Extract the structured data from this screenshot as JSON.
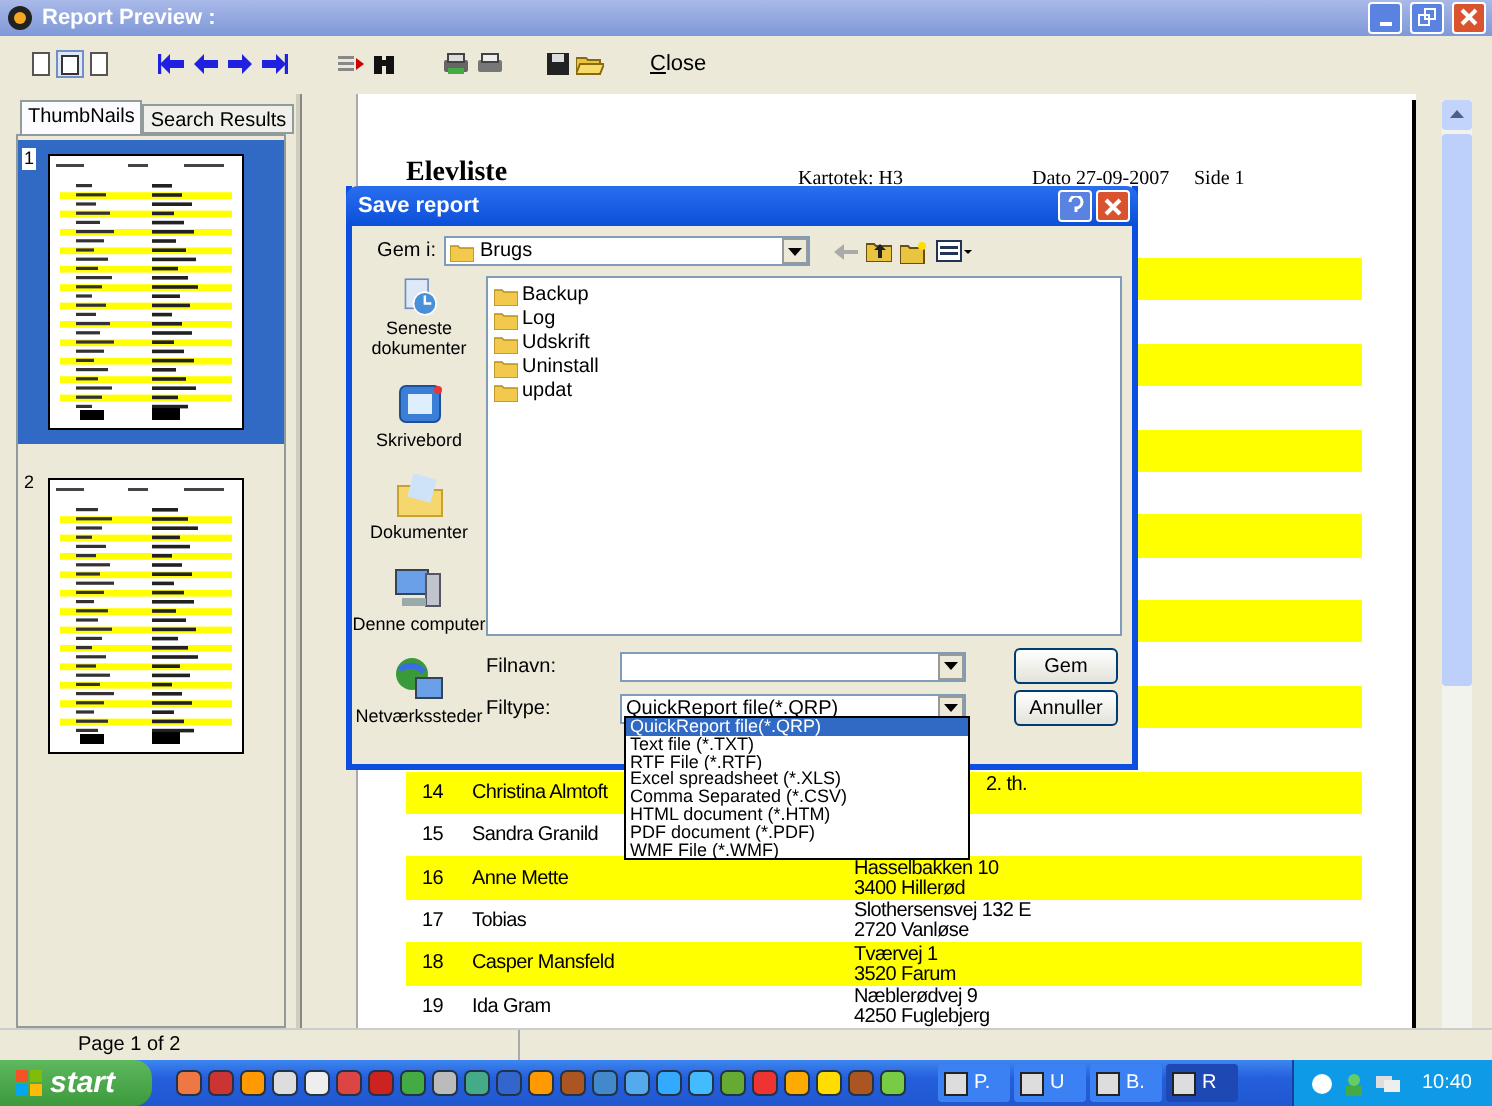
{
  "window": {
    "title": "Report Preview :"
  },
  "toolbar": {
    "close_label": "Close"
  },
  "side_tabs": [
    {
      "label": "ThumbNails",
      "selected": true
    },
    {
      "label": "Search Results",
      "selected": false
    }
  ],
  "thumbnails": [
    {
      "label": "1",
      "selected": true
    },
    {
      "label": "2",
      "selected": false
    }
  ],
  "report": {
    "title": "Elevliste",
    "register": "Kartotek: H3",
    "date": "Dato 27-09-2007",
    "page": "Side 1",
    "rows": [
      {
        "highlighted": false
      },
      {
        "highlighted": true
      },
      {
        "highlighted": false
      },
      {
        "highlighted": true
      },
      {
        "highlighted": false
      },
      {
        "highlighted": true
      },
      {
        "highlighted": false
      },
      {
        "highlighted": true
      },
      {
        "highlighted": false
      },
      {
        "highlighted": true
      },
      {
        "highlighted": false
      },
      {
        "highlighted": true
      },
      {
        "highlighted": false
      },
      {
        "number": "14",
        "name": "Christina Almtoft",
        "address": [
          "2. th."
        ],
        "covered": true,
        "highlighted": true
      },
      {
        "number": "15",
        "name": "Sandra Granild",
        "highlighted": false
      },
      {
        "number": "16",
        "name": "Anne Mette",
        "address": [
          "Hasselbakken 10",
          "3400 Hillerød"
        ],
        "covered": false,
        "highlighted": true
      },
      {
        "number": "17",
        "name": "Tobias",
        "address": [
          "Slothersensvej 132 E",
          "2720 Vanløse"
        ],
        "covered": false,
        "highlighted": false
      },
      {
        "number": "18",
        "name": "Casper Mansfeld",
        "address": [
          "Tværvej 1",
          "3520 Farum"
        ],
        "covered": false,
        "highlighted": true
      },
      {
        "number": "19",
        "name": "Ida Gram",
        "address": [
          "Næblerødvej 9",
          "4250 Fuglebjerg"
        ],
        "covered": false,
        "highlighted": false
      }
    ]
  },
  "dialog": {
    "title": "Save report",
    "look_in_label": "Gem i:",
    "look_in": "Brugs",
    "places": [
      "Seneste dokumenter",
      "Skrivebord",
      "Dokumenter",
      "Denne computer",
      "Netværkssteder"
    ],
    "folders": [
      "Backup",
      "Log",
      "Udskrift",
      "Uninstall",
      "updat"
    ],
    "filename_label": "Filnavn:",
    "filetype_label": "Filtype:",
    "filetype": "QuickReport file(*.QRP)",
    "buttons": [
      "Gem",
      "Annuller"
    ],
    "filetype_options": [
      {
        "label": "QuickReport file(*.QRP)",
        "selected": true
      },
      {
        "label": "Text file (*.TXT)",
        "selected": false
      },
      {
        "label": "RTF File (*.RTF)",
        "selected": false
      },
      {
        "label": "Excel spreadsheet (*.XLS)",
        "selected": false
      },
      {
        "label": "Comma Separated (*.CSV)",
        "selected": false
      },
      {
        "label": "HTML document (*.HTM)",
        "selected": false
      },
      {
        "label": "PDF document (*.PDF)",
        "selected": false
      },
      {
        "label": "WMF File (*.WMF)",
        "selected": false
      }
    ]
  },
  "status_bar": "Page 1 of 2",
  "taskbar": {
    "start": "start",
    "tasks": [
      {
        "label": "P.",
        "selected": false
      },
      {
        "label": "U",
        "selected": false
      },
      {
        "label": "B.",
        "selected": false
      },
      {
        "label": "R",
        "selected": true
      }
    ],
    "clock": "10:40"
  }
}
